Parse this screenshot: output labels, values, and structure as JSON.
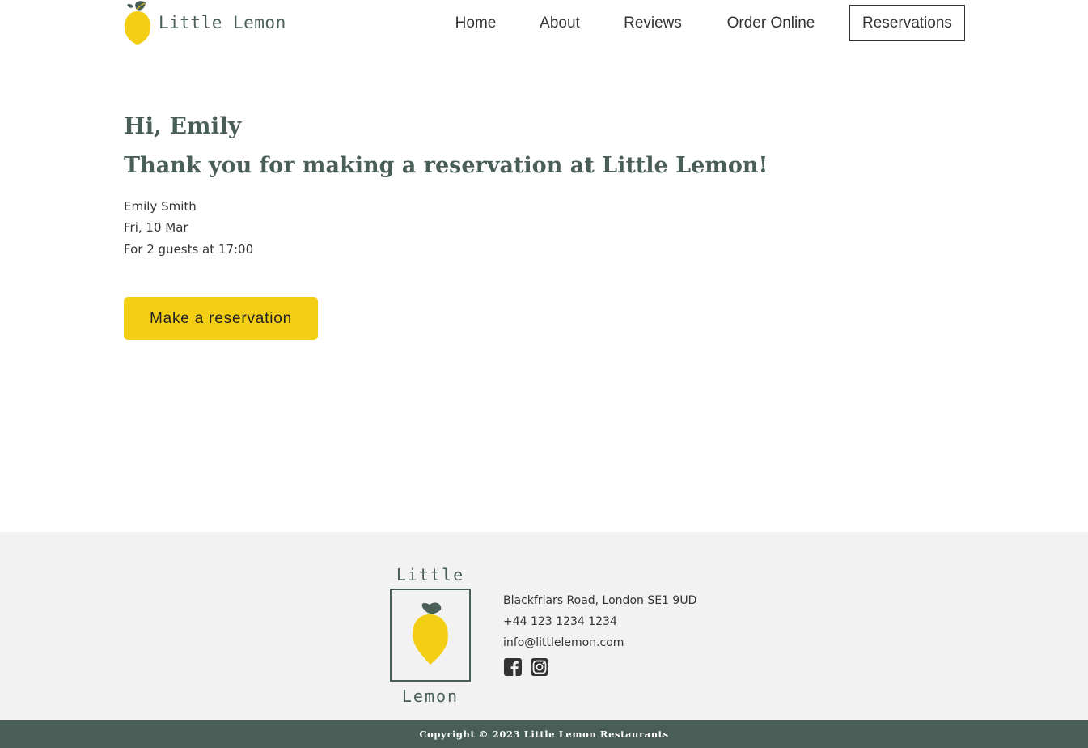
{
  "brand": {
    "name": "Little Lemon",
    "footer_word_top": "Little",
    "footer_word_bottom": "Lemon"
  },
  "nav": {
    "items": [
      {
        "label": "Home"
      },
      {
        "label": "About"
      },
      {
        "label": "Reviews"
      },
      {
        "label": "Order Online"
      },
      {
        "label": "Reservations",
        "active": true
      }
    ]
  },
  "confirmation": {
    "greeting": "Hi, Emily",
    "message": "Thank you for making a reservation at Little Lemon!",
    "name": "Emily Smith",
    "date": "Fri, 10 Mar",
    "guests_time": "For 2 guests at 17:00",
    "button_label": "Make a reservation"
  },
  "footer": {
    "address": "Blackfriars Road, London SE1 9UD",
    "phone": "+44 123 1234 1234",
    "email": "info@littlelemon.com",
    "social": [
      {
        "icon": "facebook-icon"
      },
      {
        "icon": "instagram-icon"
      }
    ],
    "copyright": "Copyright © 2023 Little Lemon Restaurants"
  },
  "colors": {
    "primary_green": "#495e57",
    "primary_yellow": "#f4ce14",
    "footer_bg": "#f2f2f2",
    "text": "#333333"
  }
}
